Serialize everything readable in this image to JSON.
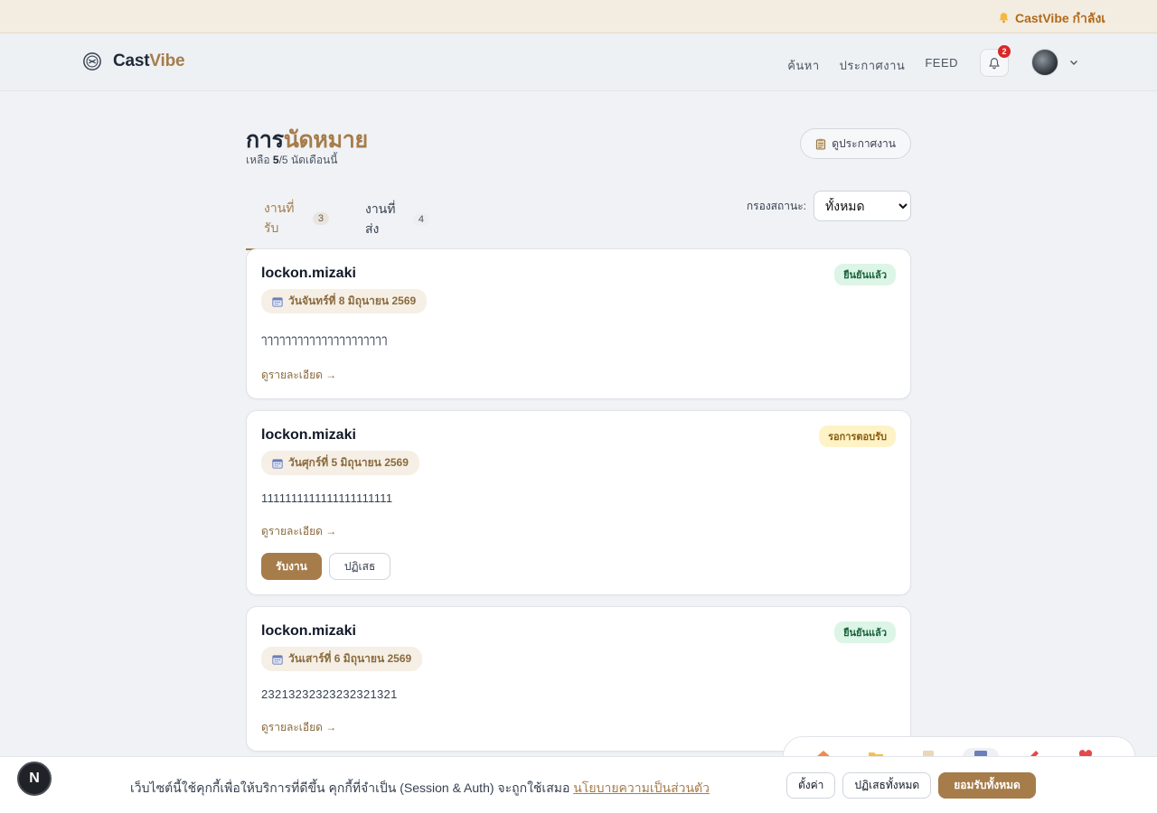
{
  "announcement": {
    "text": "CastVibe กำลังเ"
  },
  "brand": {
    "name_part1": "Cast",
    "name_part2": "Vibe"
  },
  "nav": {
    "items": [
      "ค้นหา",
      "ประกาศงาน",
      "FEED"
    ]
  },
  "notifications": {
    "count": "2"
  },
  "page": {
    "title_part1": "การ",
    "title_part2": "นัดหมาย",
    "quota_prefix": "เหลือ ",
    "quota_used": "5",
    "quota_suffix": "/5 นัดเดือนนี้",
    "view_posts_label": "ดูประกาศงาน"
  },
  "tabs": [
    {
      "label": "งานที่รับ",
      "count": "3"
    },
    {
      "label": "งานที่ส่ง",
      "count": "4"
    }
  ],
  "filter": {
    "label": "กรองสถานะ:",
    "selected": "ทั้งหมด"
  },
  "cards": [
    {
      "user": "lockon.mizaki",
      "date": "วันจันทร์ที่ 8 มิถุนายน 2569",
      "note": "ๅๅๅๅๅๅๅๅๅๅๅๅๅๅๅๅๅๅๅๅๅ",
      "detail": "ดูรายละเอียด →",
      "status": "ยืนยันแล้ว"
    },
    {
      "user": "lockon.mizaki",
      "date": "วันศุกร์ที่ 5 มิถุนายน 2569",
      "note": "1111111111111111111111",
      "detail": "ดูรายละเอียด →",
      "status": "รอการตอบรับ",
      "accept": "รับงาน",
      "reject": "ปฏิเสธ"
    },
    {
      "user": "lockon.mizaki",
      "date": "วันเสาร์ที่ 6 มิถุนายน 2569",
      "note": "23213232323232321321",
      "detail": "ดูรายละเอียด →",
      "status": "ยืนยันแล้ว"
    }
  ],
  "cookie": {
    "message": "เว็บไซต์นี้ใช้คุกกี้เพื่อให้บริการที่ดีขึ้น คุกกี้ที่จำเป็น (Session & Auth) จะถูกใช้เสมอ ",
    "policy_link": "นโยบายความเป็นส่วนตัว",
    "settings": "ตั้งค่า",
    "reject_all": "ปฏิเสธทั้งหมด",
    "accept_all": "ยอมรับทั้งหมด"
  },
  "dev_badge": {
    "letter": "N"
  },
  "colors": {
    "accent": "#a67c4a",
    "confirmed_bg": "#dcf5e6",
    "pending_bg": "#fdf3c6"
  }
}
